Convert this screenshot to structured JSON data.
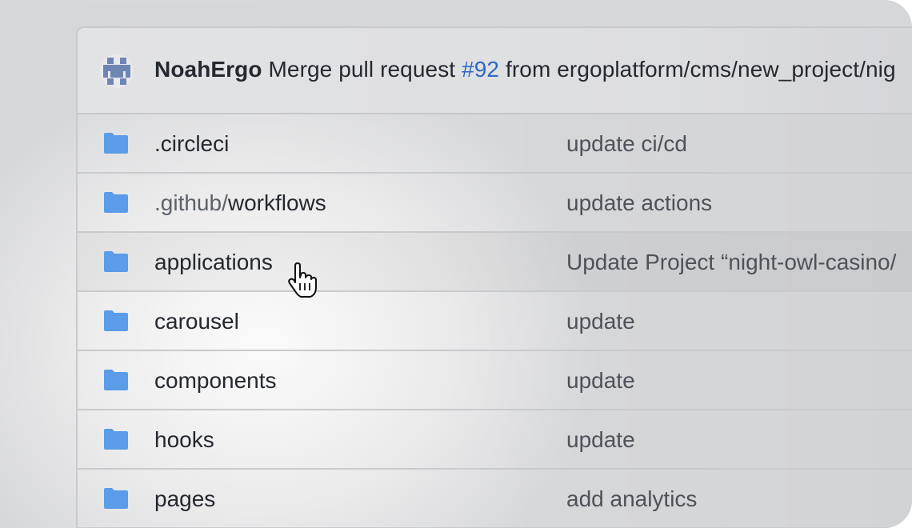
{
  "commit": {
    "author": "NoahErgo",
    "message_before": " Merge pull request ",
    "pr_number": "#92",
    "message_after": " from ergoplatform/cms/new_project/nig"
  },
  "files": [
    {
      "prefix": "",
      "name": ".circleci",
      "message": "update ci/cd"
    },
    {
      "prefix": ".github/",
      "name": "workflows",
      "message": "update actions"
    },
    {
      "prefix": "",
      "name": "applications",
      "message": "Update Project “night-owl-casino/"
    },
    {
      "prefix": "",
      "name": "carousel",
      "message": "update"
    },
    {
      "prefix": "",
      "name": "components",
      "message": "update"
    },
    {
      "prefix": "",
      "name": "hooks",
      "message": "update"
    },
    {
      "prefix": "",
      "name": "pages",
      "message": "add analytics"
    }
  ],
  "colors": {
    "folder": "#5b9ce8",
    "link": "#2f68c6",
    "text": "#24292f",
    "muted": "#4d5258"
  },
  "icons": {
    "folder": "folder-icon",
    "avatar": "identicon-avatar",
    "cursor": "hand-pointer-cursor"
  }
}
